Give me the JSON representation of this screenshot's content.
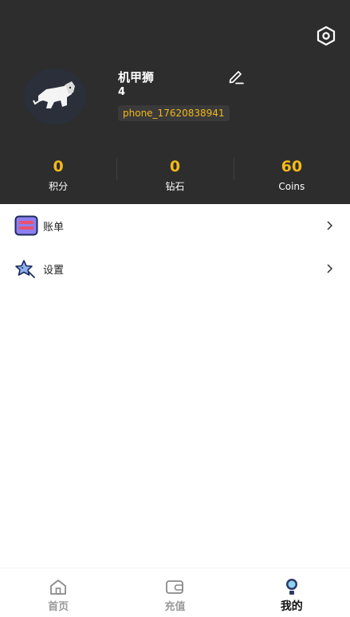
{
  "profile": {
    "nickname": "机甲狮",
    "level": "4",
    "phone": "phone_17620838941"
  },
  "stats": [
    {
      "value": "0",
      "label": "积分"
    },
    {
      "value": "0",
      "label": "钻石"
    },
    {
      "value": "60",
      "label": "Coins"
    }
  ],
  "menu": [
    {
      "label": "账单",
      "icon": "bill-icon"
    },
    {
      "label": "设置",
      "icon": "settings-star-icon"
    }
  ],
  "tabs": [
    {
      "label": "首页",
      "icon": "home-icon",
      "active": false
    },
    {
      "label": "充值",
      "icon": "wallet-icon",
      "active": false
    },
    {
      "label": "我的",
      "icon": "profile-icon",
      "active": true
    }
  ],
  "colors": {
    "header_bg": "#2d2d2d",
    "accent": "#f3b81b"
  }
}
